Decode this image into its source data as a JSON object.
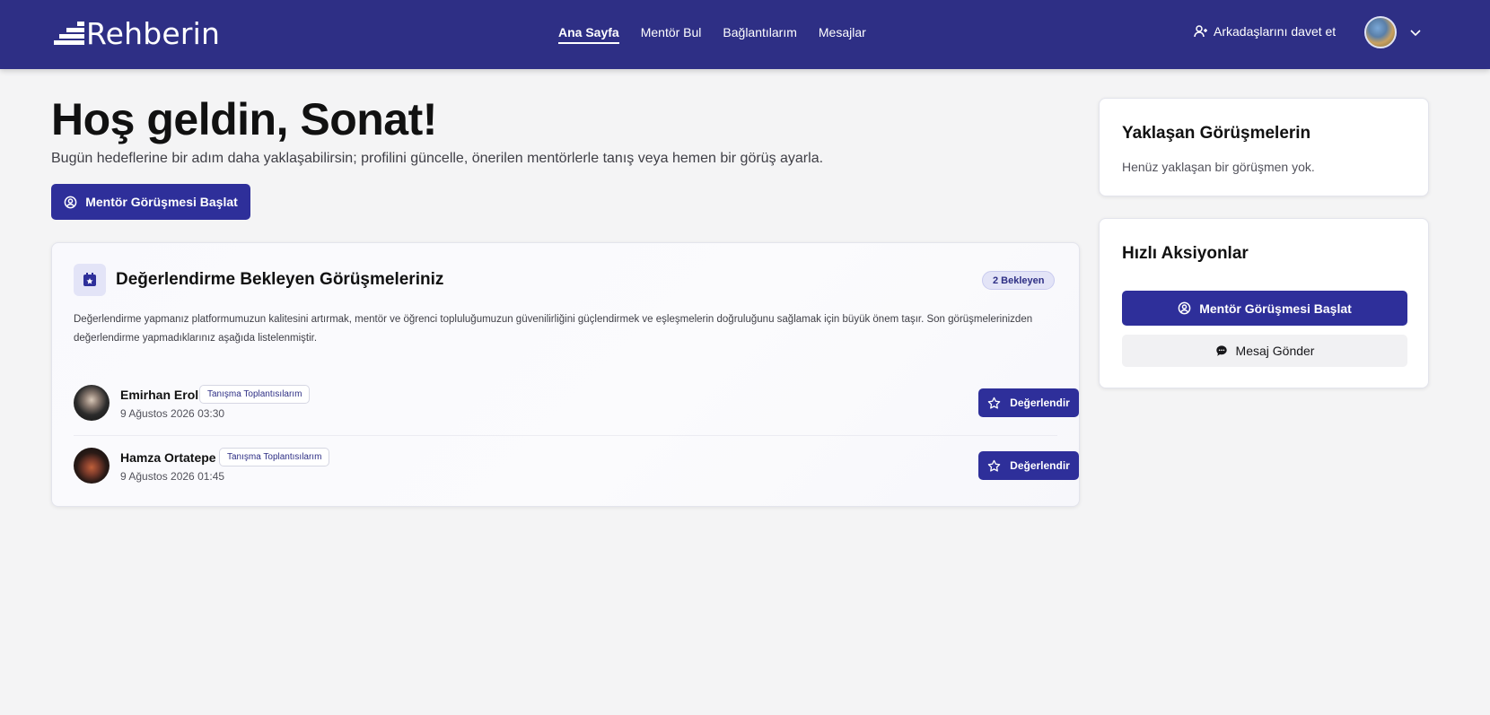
{
  "header": {
    "logo_text": "Rehberin",
    "nav": [
      {
        "label": "Ana Sayfa",
        "active": true
      },
      {
        "label": "Mentör Bul",
        "active": false
      },
      {
        "label": "Bağlantılarım",
        "active": false
      },
      {
        "label": "Mesajlar",
        "active": false
      }
    ],
    "invite_label": "Arkadaşlarını davet et",
    "icons": [
      "user-plus-icon",
      "avatar",
      "chevron-down-icon"
    ],
    "brand_color": "#2e2f85"
  },
  "hero": {
    "title": "Hoş geldin, Sonat!",
    "subtitle": "Bugün hedeflerine bir adım daha yaklaşabilirsin; profilini güncelle, önerilen mentörlerle tanış veya hemen bir görüş ayarla.",
    "cta_label": "Mentör Görüşmesi Başlat"
  },
  "review": {
    "title": "Değerlendirme Bekleyen Görüşmeleriniz",
    "badge": "2 Bekleyen",
    "description": "Değerlendirme yapmanız platformumuzun kalitesini artırmak, mentör ve öğrenci topluluğumuzun güvenilirliğini güçlendirmek ve eşleşmelerin doğruluğunu sağlamak için büyük önem taşır. Son görüşmelerinizden değerlendirme yapmadıklarınız aşağıda listelenmiştir.",
    "rate_label": "Değerlendir",
    "meetings": [
      {
        "name": "Emirhan Erol",
        "tag": "Tanışma Toplantısılarım",
        "date": "9 Ağustos 2026 03:30"
      },
      {
        "name": "Hamza Ortatepe",
        "tag": "Tanışma Toplantısılarım",
        "date": "9 Ağustos 2026 01:45"
      }
    ]
  },
  "upcoming": {
    "title": "Yaklaşan Görüşmelerin",
    "empty_text": "Henüz yaklaşan bir görüşmen yok."
  },
  "quick_actions": {
    "title": "Hızlı Aksiyonlar",
    "primary_label": "Mentör Görüşmesi Başlat",
    "secondary_label": "Mesaj Gönder"
  }
}
